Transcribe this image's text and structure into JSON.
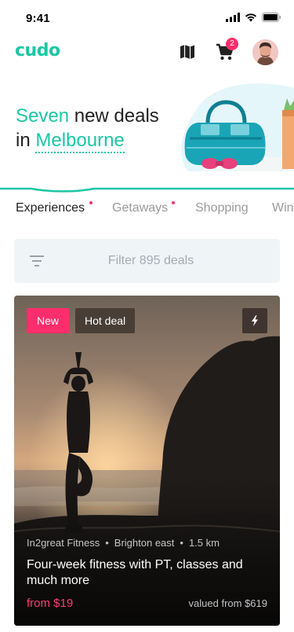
{
  "status_bar": {
    "time": "9:41"
  },
  "header": {
    "logo": "cudo",
    "cart_count": "2"
  },
  "hero": {
    "line1_highlight": "Seven",
    "line1_rest": " new deals",
    "line2_prefix": "in ",
    "city": "Melbourne"
  },
  "tabs": [
    {
      "label": "Experiences",
      "active": true,
      "dot": true
    },
    {
      "label": "Getaways",
      "active": false,
      "dot": true
    },
    {
      "label": "Shopping",
      "active": false,
      "dot": false
    },
    {
      "label": "Win",
      "active": false,
      "dot": false
    }
  ],
  "filter": {
    "label": "Filter 895 deals"
  },
  "deal": {
    "badge_new": "New",
    "badge_hot": "Hot deal",
    "merchant": "In2great Fitness",
    "location": "Brighton east",
    "distance": "1.5 km",
    "title": "Four-week fitness with PT, classes and much more",
    "price": "from $19",
    "valued": "valued from $619"
  },
  "colors": {
    "brand": "#1cc6a5",
    "accent": "#ff2d6b",
    "filter_bg": "#eff4f7"
  },
  "icons": [
    "signal-icon",
    "wifi-icon",
    "battery-icon",
    "map-icon",
    "cart-icon",
    "filter-icon",
    "flash-icon"
  ]
}
